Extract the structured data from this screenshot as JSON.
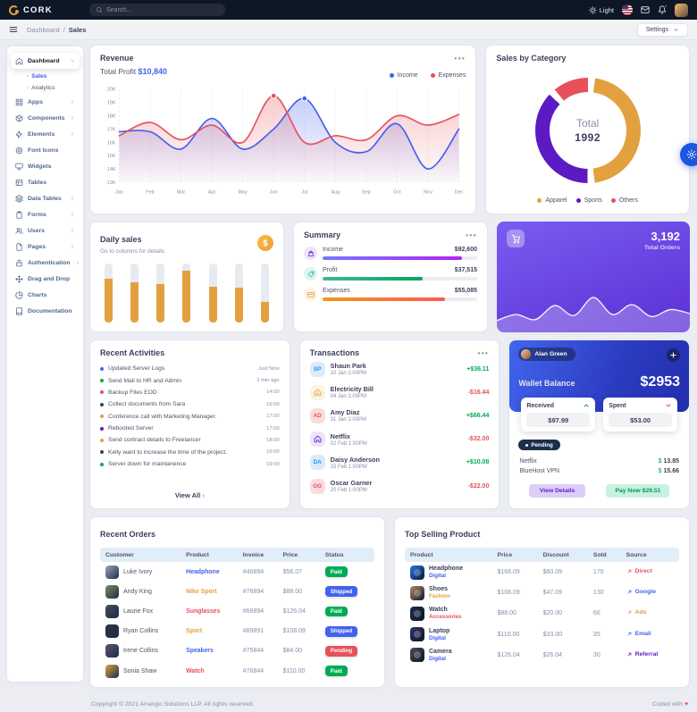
{
  "topbar": {
    "brand": "CORK",
    "search_placeholder": "Search...",
    "theme_label": "Light"
  },
  "subheader": {
    "breadcrumb": {
      "root": "Dashboard",
      "separator": "/",
      "current": "Sales"
    },
    "settings_label": "Settings"
  },
  "sidebar": {
    "items": [
      {
        "label": "Dashboard",
        "icon": "home",
        "chevron": "down",
        "active": true,
        "children": [
          {
            "label": "Sales",
            "active": true
          },
          {
            "label": "Analytics",
            "active": false
          }
        ]
      },
      {
        "label": "Apps",
        "icon": "grid",
        "chevron": "right"
      },
      {
        "label": "Components",
        "icon": "package",
        "chevron": "right"
      },
      {
        "label": "Elements",
        "icon": "zap",
        "chevron": "right"
      },
      {
        "label": "Font Icons",
        "icon": "target"
      },
      {
        "label": "Widgets",
        "icon": "monitor"
      },
      {
        "label": "Tables",
        "icon": "table"
      },
      {
        "label": "Data Tables",
        "icon": "layers",
        "chevron": "right"
      },
      {
        "label": "Forms",
        "icon": "clipboard",
        "chevron": "right"
      },
      {
        "label": "Users",
        "icon": "users",
        "chevron": "right"
      },
      {
        "label": "Pages",
        "icon": "file",
        "chevron": "right"
      },
      {
        "label": "Authentication",
        "icon": "lock",
        "chevron": "right"
      },
      {
        "label": "Drag and Drop",
        "icon": "move"
      },
      {
        "label": "Charts",
        "icon": "pie-chart"
      },
      {
        "label": "Documentation",
        "icon": "book"
      }
    ]
  },
  "revenue": {
    "title": "Revenue",
    "total_profit_label": "Total Profit",
    "total_profit_value": "$10,840",
    "chart_data": {
      "type": "line",
      "x": [
        "Jan",
        "Feb",
        "Mar",
        "Apr",
        "May",
        "Jun",
        "Jul",
        "Aug",
        "Sep",
        "Oct",
        "Nov",
        "Dec"
      ],
      "series": [
        {
          "name": "Income",
          "color": "#4361ee",
          "values": [
            16800,
            16800,
            15500,
            17800,
            15500,
            17000,
            19300,
            16000,
            15300,
            17400,
            14000,
            17000
          ],
          "marker_index": 6
        },
        {
          "name": "Expenses",
          "color": "#e7515a",
          "values": [
            16500,
            17500,
            16200,
            17300,
            16000,
            19500,
            16000,
            16500,
            16200,
            18000,
            17300,
            18100
          ],
          "marker_index": 5
        }
      ],
      "ylim": [
        13000,
        20000
      ],
      "ytick_labels": [
        "13K",
        "14K",
        "15K",
        "16K",
        "17K",
        "18K",
        "19K",
        "20K"
      ],
      "grid": "vertical-dashed",
      "legend_position": "top-right"
    }
  },
  "sales_by_category": {
    "title": "Sales by Category",
    "center_label": "Total",
    "center_value": "1992",
    "chart_data": {
      "type": "pie",
      "labels": [
        "Apparel",
        "Sports",
        "Others"
      ],
      "values": [
        975,
        785,
        232
      ],
      "colors": [
        "#e2a03f",
        "#5c1ac3",
        "#e7515a"
      ],
      "total": 1992,
      "legend_position": "bottom"
    }
  },
  "daily_sales": {
    "title": "Daily sales",
    "subtitle": "Go to columns for details.",
    "chart_data": {
      "type": "bar",
      "stacked": true,
      "series": [
        {
          "name": "Sales",
          "color": "#e2a03f",
          "values": [
            75,
            68,
            65,
            88,
            61,
            59,
            35
          ]
        },
        {
          "name": "Remainder",
          "color": "#e6eaf1",
          "values": [
            25,
            32,
            35,
            12,
            39,
            41,
            65
          ]
        }
      ]
    }
  },
  "summary": {
    "title": "Summary",
    "rows": [
      {
        "label": "Income",
        "value": "$92,600",
        "pct": 90,
        "icon": "shopping-bag",
        "icon_color": "#5c1ac3",
        "icon_bg": "#ece4fc",
        "gradient": [
          "#7579ff",
          "#b224ef"
        ]
      },
      {
        "label": "Profit",
        "value": "$37,515",
        "pct": 65,
        "icon": "tag",
        "icon_color": "#1abc9c",
        "icon_bg": "#ddf5f0",
        "gradient": [
          "#3cba92",
          "#0ba360"
        ]
      },
      {
        "label": "Expenses",
        "value": "$55,085",
        "pct": 79,
        "icon": "credit-card",
        "icon_color": "#e2a03f",
        "icon_bg": "#fcf3e1",
        "gradient": [
          "#f09819",
          "#ff5858"
        ]
      }
    ]
  },
  "total_orders": {
    "value": "3,192",
    "label": "Total Orders",
    "chart_data": {
      "type": "area",
      "values": [
        20,
        32,
        22,
        50,
        30,
        66,
        32,
        52,
        28,
        42,
        34
      ]
    }
  },
  "recent_activities": {
    "title": "Recent Activities",
    "view_all": "View All",
    "items": [
      {
        "text": "Updated Server Logs",
        "time": "Just Now",
        "color": "#4361ee"
      },
      {
        "text": "Send Mail to HR and Admin",
        "time": "2 min ago",
        "color": "#00ab55"
      },
      {
        "text": "Backup Files EOD",
        "time": "14:00",
        "color": "#e7515a"
      },
      {
        "text": "Collect documents from Sara",
        "time": "16:00",
        "color": "#3b3f5c"
      },
      {
        "text": "Conference call with Marketing Manager.",
        "time": "17:00",
        "color": "#e2a03f"
      },
      {
        "text": "Rebooted Server",
        "time": "17:00",
        "color": "#5c1ac3"
      },
      {
        "text": "Send contract details to Freelancer",
        "time": "18:00",
        "color": "#e2a03f"
      },
      {
        "text": "Kelly want to increase the time of the project.",
        "time": "19:00",
        "color": "#3b3f5c"
      },
      {
        "text": "Server down for maintanence",
        "time": "19:00",
        "color": "#00ab55"
      }
    ]
  },
  "transactions": {
    "title": "Transactions",
    "items": [
      {
        "name": "Shaun Park",
        "date": "10 Jan 1:00PM",
        "amount": "+$36.11",
        "positive": true,
        "avatar": "SP",
        "icon": null,
        "fg": "#2196f3",
        "bg": "#dcebfb"
      },
      {
        "name": "Electricity Bill",
        "date": "04 Jan 1:00PM",
        "amount": "-$16.44",
        "positive": false,
        "avatar": null,
        "icon": "home",
        "fg": "#e2a03f",
        "bg": "#fcf3e1"
      },
      {
        "name": "Amy Diaz",
        "date": "31 Jan 1:00PM",
        "amount": "+$66.44",
        "positive": true,
        "avatar": "AD",
        "icon": null,
        "fg": "#e7515a",
        "bg": "#fbdcde"
      },
      {
        "name": "Netflix",
        "date": "02 Feb 1:00PM",
        "amount": "-$32.00",
        "positive": false,
        "avatar": null,
        "icon": "home",
        "fg": "#5c1ac3",
        "bg": "#ece4fc"
      },
      {
        "name": "Daisy Anderson",
        "date": "15 Feb 1:00PM",
        "amount": "+$10.08",
        "positive": true,
        "avatar": "DA",
        "icon": null,
        "fg": "#2196f3",
        "bg": "#dcebfb"
      },
      {
        "name": "Oscar Garner",
        "date": "20 Feb 1:00PM",
        "amount": "-$22.00",
        "positive": false,
        "avatar": "OG",
        "icon": null,
        "fg": "#e7515a",
        "bg": "#fbdcde"
      }
    ],
    "positive_color": "#00ab55",
    "negative_color": "#e7515a"
  },
  "wallet": {
    "user": "Alan Green",
    "title": "Wallet Balance",
    "amount": "$2953",
    "received_label": "Received",
    "received_value": "$97.99",
    "spent_label": "Spent",
    "spent_value": "$53.00",
    "pending_label": "Pending",
    "items": [
      {
        "name": "Netflix",
        "currency": "$",
        "amount": "13.85"
      },
      {
        "name": "BlueHost VPN",
        "currency": "$",
        "amount": "15.66"
      }
    ],
    "view_details_label": "View Details",
    "pay_now_label": "Pay Now $29.51"
  },
  "recent_orders": {
    "title": "Recent Orders",
    "headers": [
      "Customer",
      "Product",
      "Invoice",
      "Price",
      "Status"
    ],
    "rows": [
      {
        "customer": "Luke Ivory",
        "avatar_color": "#9aa8b5",
        "product": "Headphone",
        "product_color": "#4361ee",
        "invoice": "#46894",
        "price": "$56.07",
        "status": "Paid",
        "status_bg": "#00ab55"
      },
      {
        "customer": "Andy King",
        "avatar_color": "#7d8c5c",
        "product": "Nike Sport",
        "product_color": "#e2a03f",
        "invoice": "#76894",
        "price": "$88.00",
        "status": "Shipped",
        "status_bg": "#4361ee"
      },
      {
        "customer": "Laurie Fox",
        "avatar_color": "#4a4a56",
        "product": "Sunglasses",
        "product_color": "#e7515a",
        "invoice": "#66894",
        "price": "$126.04",
        "status": "Paid",
        "status_bg": "#00ab55"
      },
      {
        "customer": "Ryan Collins",
        "avatar_color": "#31343d",
        "product": "Sport",
        "product_color": "#e2a03f",
        "invoice": "#89891",
        "price": "$108.09",
        "status": "Shipped",
        "status_bg": "#4361ee"
      },
      {
        "customer": "Irene Collins",
        "avatar_color": "#5c5470",
        "product": "Speakers",
        "product_color": "#4361ee",
        "invoice": "#75844",
        "price": "$84.00",
        "status": "Pending",
        "status_bg": "#e7515a"
      },
      {
        "customer": "Sonia Shaw",
        "avatar_color": "#e2a03f",
        "product": "Watch",
        "product_color": "#e7515a",
        "invoice": "#76844",
        "price": "$110.00",
        "status": "Paid",
        "status_bg": "#00ab55"
      }
    ]
  },
  "top_selling": {
    "title": "Top Selling Product",
    "headers": [
      "Product",
      "Price",
      "Discount",
      "Sold",
      "Source"
    ],
    "rows": [
      {
        "product": "Headphone",
        "tag": "Digital",
        "tag_color": "#4361ee",
        "thumb": "#2178f3",
        "price": "$168.09",
        "discount": "$60.09",
        "sold": "170",
        "source": "Direct",
        "source_color": "#e7515a"
      },
      {
        "product": "Shoes",
        "tag": "Fashion",
        "tag_color": "#e2a03f",
        "thumb": "#b08968",
        "price": "$108.09",
        "discount": "$47.09",
        "sold": "130",
        "source": "Google",
        "source_color": "#4361ee"
      },
      {
        "product": "Watch",
        "tag": "Accessories",
        "tag_color": "#e7515a",
        "thumb": "#1b2e4b",
        "price": "$88.00",
        "discount": "$20.00",
        "sold": "66",
        "source": "Ads",
        "source_color": "#e2a03f"
      },
      {
        "product": "Laptop",
        "tag": "Digital",
        "tag_color": "#4361ee",
        "thumb": "#30336b",
        "price": "$110.00",
        "discount": "$33.00",
        "sold": "35",
        "source": "Email",
        "source_color": "#4361ee"
      },
      {
        "product": "Camera",
        "tag": "Digital",
        "tag_color": "#4361ee",
        "thumb": "#4b4b55",
        "price": "$126.04",
        "discount": "$26.04",
        "sold": "30",
        "source": "Referral",
        "source_color": "#5c1ac3"
      }
    ]
  },
  "footer": {
    "copyright": "Copyright © 2021 Arrangic Solutions LLP. All rights reserved.",
    "coded_with": "Coded with",
    "heart": "♥"
  }
}
